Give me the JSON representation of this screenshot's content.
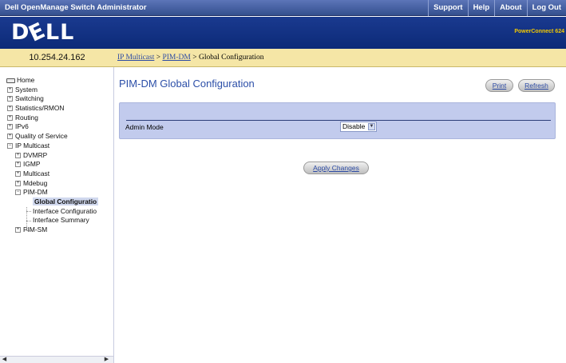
{
  "topbar": {
    "title": "Dell OpenManage Switch Administrator",
    "links": [
      "Support",
      "Help",
      "About",
      "Log Out"
    ]
  },
  "banner": {
    "logo": "DELL",
    "product": "PowerConnect 624"
  },
  "ip_address": "10.254.24.162",
  "nav": {
    "home": "Home",
    "system": "System",
    "switching": "Switching",
    "statistics": "Statistics/RMON",
    "routing": "Routing",
    "ipv6": "IPv6",
    "qos": "Quality of Service",
    "ip_multicast": "IP Multicast",
    "dvmrp": "DVMRP",
    "igmp": "IGMP",
    "multicast": "Multicast",
    "mdebug": "Mdebug",
    "pim_dm": "PIM-DM",
    "global_config": "Global Configuratio",
    "interface_config": "Interface Configuratio",
    "interface_summary": "Interface Summary",
    "pim_sm": "PIM-SM"
  },
  "breadcrumb": {
    "ip_multicast": "IP Multicast",
    "sep": " > ",
    "pim_dm": "PIM-DM",
    "current": "Global Configuration"
  },
  "page": {
    "title": "PIM-DM Global Configuration",
    "print_label": "Print",
    "refresh_label": "Refresh",
    "admin_mode_label": "Admin Mode",
    "admin_mode_value": "Disable",
    "apply_label": "Apply Changes"
  },
  "colors": {
    "topbar": "#34508f",
    "banner": "#0c2a78",
    "accent_yellow": "#f5e6a6",
    "panel": "#c2cbed",
    "title_blue": "#2c4fa8"
  },
  "icons": {
    "home": "home-icon",
    "expand": "plus-icon",
    "collapse": "minus-icon",
    "dropdown": "chevron-down-icon"
  }
}
